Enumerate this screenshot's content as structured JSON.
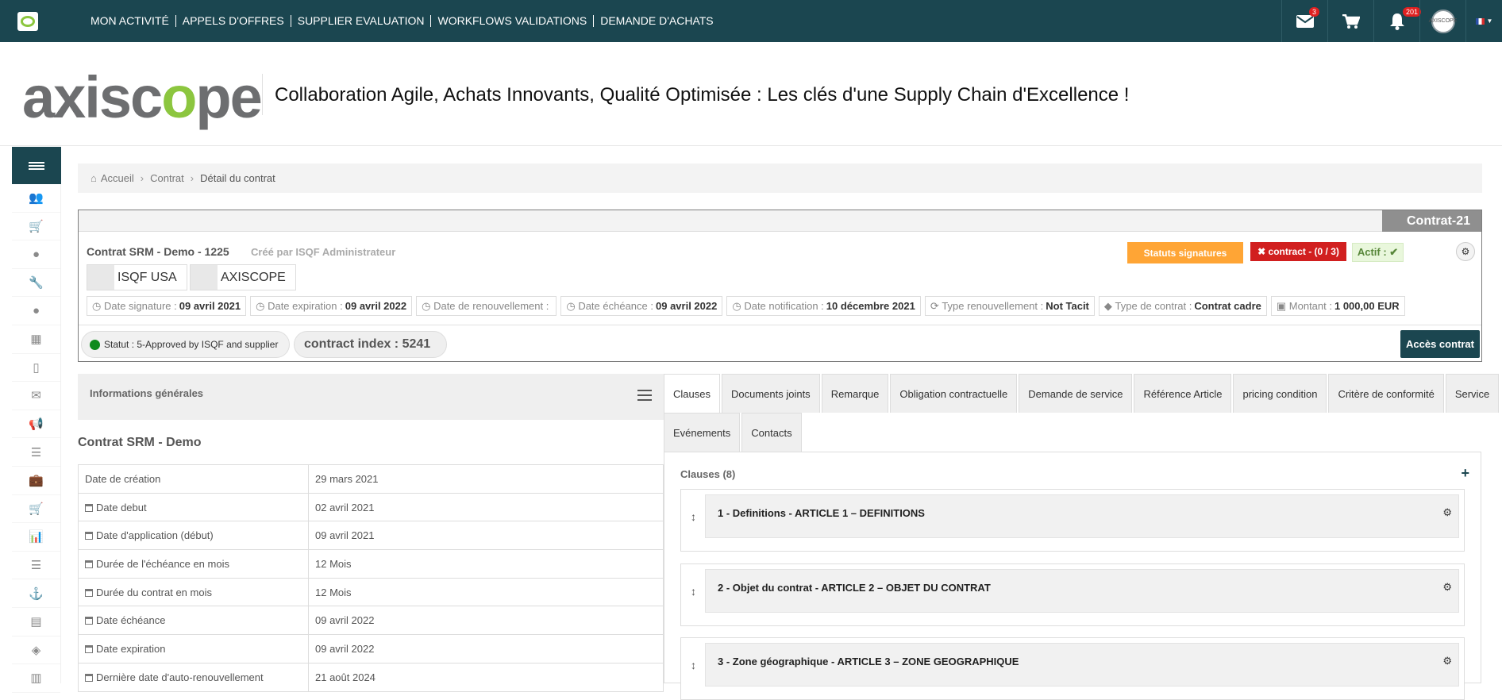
{
  "topnav": {
    "items": [
      "MON ACTIVITÉ",
      "APPELS D'OFFRES",
      "SUPPLIER EVALUATION",
      "WORKFLOWS VALIDATIONS",
      "DEMANDE D'ACHATS"
    ],
    "mail_count": "3",
    "notif_count": "201",
    "avatar_text": "AXISCOPE"
  },
  "brand": {
    "wordmark_a": "axisc",
    "wordmark_b": "o",
    "wordmark_c": "pe",
    "tagline": "Collaboration Agile, Achats Innovants, Qualité Optimisée : Les clés d'une Supply Chain d'Excellence !"
  },
  "breadcrumb": {
    "home": "Accueil",
    "contract": "Contrat",
    "current": "Détail du contrat"
  },
  "contract": {
    "ribbon": "Contrat-21",
    "title": "Contrat SRM - Demo - 1225",
    "created_by": "Créé par ISQF Administrateur",
    "party1": "ISQF USA",
    "party2": "AXISCOPE",
    "btn_status": "Statuts signatures",
    "btn_contract": "✖ contract - (0 / 3)",
    "btn_actif": "Actif : ✔",
    "infos": [
      {
        "label": "Date signature :",
        "value": "09 avril 2021"
      },
      {
        "label": "Date expiration :",
        "value": "09 avril 2022"
      },
      {
        "label": "Date de renouvellement :",
        "value": ""
      },
      {
        "label": "Date échéance :",
        "value": "09 avril 2022"
      },
      {
        "label": "Date notification :",
        "value": "10 décembre 2021"
      },
      {
        "label": "Type renouvellement :",
        "value": "Not Tacit"
      },
      {
        "label": "Type de contrat :",
        "value": "Contrat cadre"
      },
      {
        "label": "Montant :",
        "value": "1 000,00  EUR"
      }
    ],
    "statut": "Statut : 5-Approved by ISQF and supplier",
    "index": "contract index : 5241",
    "btn_acces": "Accès contrat"
  },
  "general": {
    "header": "Informations générales",
    "title": "Contrat SRM - Demo",
    "rows": [
      {
        "k": "Date de création",
        "v": "29 mars 2021",
        "icon": false
      },
      {
        "k": "Date debut",
        "v": "02 avril 2021",
        "icon": true
      },
      {
        "k": "Date d'application (début)",
        "v": "09 avril 2021",
        "icon": true
      },
      {
        "k": "Durée de l'échéance en mois",
        "v": "12 Mois",
        "icon": true
      },
      {
        "k": "Durée du contrat en mois",
        "v": "12 Mois",
        "icon": true
      },
      {
        "k": "Date échéance",
        "v": "09 avril 2022",
        "icon": true
      },
      {
        "k": "Date expiration",
        "v": "09 avril 2022",
        "icon": true
      },
      {
        "k": "Dernière date d'auto-renouvellement",
        "v": "21 août 2024",
        "icon": true
      }
    ]
  },
  "tabs": {
    "row1": [
      "Clauses",
      "Documents joints",
      "Remarque",
      "Obligation contractuelle",
      "Demande de service",
      "Référence Article",
      "pricing condition",
      "Critère de conformité",
      "Service"
    ],
    "row2": [
      "Evénements",
      "Contacts"
    ]
  },
  "clauses": {
    "header": "Clauses (8)",
    "items": [
      "1 - Definitions - ARTICLE 1 – DEFINITIONS",
      "2 - Objet du contrat - ARTICLE 2 – OBJET DU CONTRAT",
      "3 - Zone géographique - ARTICLE 3 – ZONE GEOGRAPHIQUE"
    ]
  }
}
